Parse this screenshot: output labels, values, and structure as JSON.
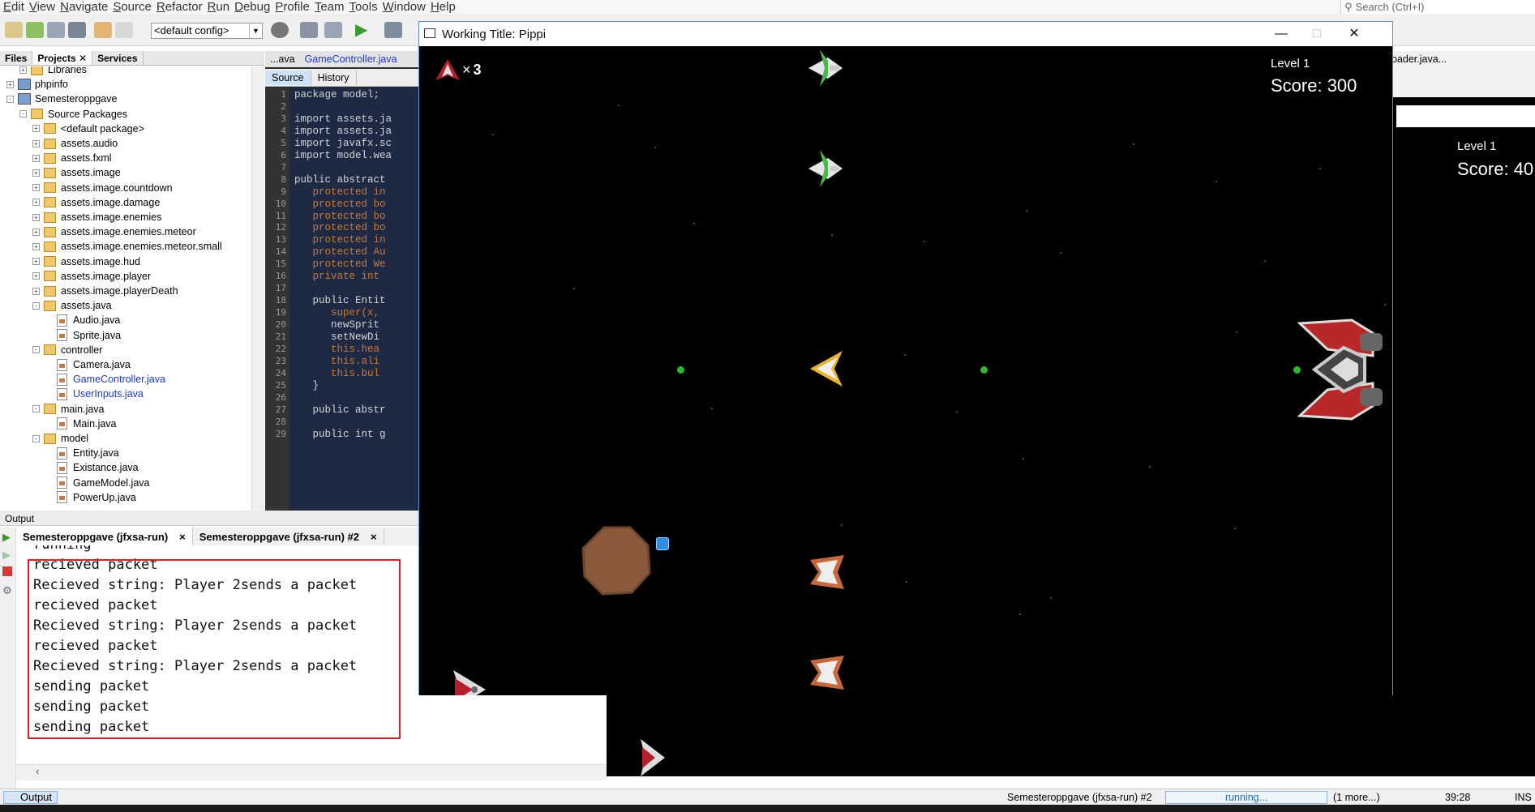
{
  "menu": [
    "Edit",
    "View",
    "Navigate",
    "Source",
    "Refactor",
    "Run",
    "Debug",
    "Profile",
    "Team",
    "Tools",
    "Window",
    "Help"
  ],
  "search": {
    "placeholder": "Search (Ctrl+I)"
  },
  "toolbar": {
    "config": "<default config>"
  },
  "project_tabs": [
    "Files",
    "Projects",
    "Services"
  ],
  "tree": [
    {
      "label": "Libraries",
      "indent": 1,
      "kind": "folder",
      "exp": "+"
    },
    {
      "label": "phpinfo",
      "indent": 0,
      "kind": "project",
      "exp": "+"
    },
    {
      "label": "Semesteroppgave",
      "indent": 0,
      "kind": "project",
      "exp": "-"
    },
    {
      "label": "Source Packages",
      "indent": 1,
      "kind": "pkg",
      "exp": "-"
    },
    {
      "label": "<default package>",
      "indent": 2,
      "kind": "pkg",
      "exp": "+"
    },
    {
      "label": "assets.audio",
      "indent": 2,
      "kind": "pkg",
      "exp": "+"
    },
    {
      "label": "assets.fxml",
      "indent": 2,
      "kind": "pkg",
      "exp": "+"
    },
    {
      "label": "assets.image",
      "indent": 2,
      "kind": "pkg",
      "exp": "+"
    },
    {
      "label": "assets.image.countdown",
      "indent": 2,
      "kind": "pkg",
      "exp": "+"
    },
    {
      "label": "assets.image.damage",
      "indent": 2,
      "kind": "pkg",
      "exp": "+"
    },
    {
      "label": "assets.image.enemies",
      "indent": 2,
      "kind": "pkg",
      "exp": "+"
    },
    {
      "label": "assets.image.enemies.meteor",
      "indent": 2,
      "kind": "pkg",
      "exp": "+"
    },
    {
      "label": "assets.image.enemies.meteor.small",
      "indent": 2,
      "kind": "pkg",
      "exp": "+"
    },
    {
      "label": "assets.image.hud",
      "indent": 2,
      "kind": "pkg",
      "exp": "+"
    },
    {
      "label": "assets.image.player",
      "indent": 2,
      "kind": "pkg",
      "exp": "+"
    },
    {
      "label": "assets.image.playerDeath",
      "indent": 2,
      "kind": "pkg",
      "exp": "+"
    },
    {
      "label": "assets.java",
      "indent": 2,
      "kind": "pkg",
      "exp": "-"
    },
    {
      "label": "Audio.java",
      "indent": 3,
      "kind": "file"
    },
    {
      "label": "Sprite.java",
      "indent": 3,
      "kind": "file"
    },
    {
      "label": "controller",
      "indent": 2,
      "kind": "pkg",
      "exp": "-"
    },
    {
      "label": "Camera.java",
      "indent": 3,
      "kind": "file"
    },
    {
      "label": "GameController.java",
      "indent": 3,
      "kind": "file",
      "blue": true
    },
    {
      "label": "UserInputs.java",
      "indent": 3,
      "kind": "file",
      "blue": true
    },
    {
      "label": "main.java",
      "indent": 2,
      "kind": "pkg",
      "exp": "-"
    },
    {
      "label": "Main.java",
      "indent": 3,
      "kind": "file"
    },
    {
      "label": "model",
      "indent": 2,
      "kind": "pkg",
      "exp": "-"
    },
    {
      "label": "Entity.java",
      "indent": 3,
      "kind": "file"
    },
    {
      "label": "Existance.java",
      "indent": 3,
      "kind": "file"
    },
    {
      "label": "GameModel.java",
      "indent": 3,
      "kind": "file"
    },
    {
      "label": "PowerUp.java",
      "indent": 3,
      "kind": "file"
    }
  ],
  "editor": {
    "tabs": [
      "...ava",
      "GameController.java"
    ],
    "source_tab": "Source",
    "history_tab": "History",
    "lines": [
      {
        "n": "1",
        "code": "package model;",
        "cls": "pl"
      },
      {
        "n": "2",
        "code": "",
        "cls": "pl"
      },
      {
        "n": "3",
        "code": "import assets.ja",
        "cls": "pl"
      },
      {
        "n": "4",
        "code": "import assets.ja",
        "cls": "pl"
      },
      {
        "n": "5",
        "code": "import javafx.sc",
        "cls": "pl"
      },
      {
        "n": "6",
        "code": "import model.wea",
        "cls": "pl"
      },
      {
        "n": "7",
        "code": "",
        "cls": "pl"
      },
      {
        "n": "8",
        "code": "public abstract",
        "cls": "pl"
      },
      {
        "n": "9",
        "code": "   protected in",
        "cls": "kw"
      },
      {
        "n": "10",
        "code": "   protected bo",
        "cls": "kw"
      },
      {
        "n": "11",
        "code": "   protected bo",
        "cls": "kw"
      },
      {
        "n": "12",
        "code": "   protected bo",
        "cls": "kw"
      },
      {
        "n": "13",
        "code": "   protected in",
        "cls": "kw"
      },
      {
        "n": "14",
        "code": "   protected Au",
        "cls": "kw"
      },
      {
        "n": "15",
        "code": "   protected We",
        "cls": "kw"
      },
      {
        "n": "16",
        "code": "   private int",
        "cls": "kw"
      },
      {
        "n": "17",
        "code": "",
        "cls": "pl"
      },
      {
        "n": "18",
        "code": "   public Entit",
        "cls": "pl"
      },
      {
        "n": "19",
        "code": "      super(x,",
        "cls": "kw"
      },
      {
        "n": "20",
        "code": "      newSprit",
        "cls": "pl"
      },
      {
        "n": "21",
        "code": "      setNewDi",
        "cls": "pl"
      },
      {
        "n": "22",
        "code": "      this.hea",
        "cls": "kw"
      },
      {
        "n": "23",
        "code": "      this.ali",
        "cls": "kw"
      },
      {
        "n": "24",
        "code": "      this.bul",
        "cls": "kw"
      },
      {
        "n": "25",
        "code": "   }",
        "cls": "pl"
      },
      {
        "n": "26",
        "code": "",
        "cls": "pl"
      },
      {
        "n": "27",
        "code": "   public abstr",
        "cls": "pl"
      },
      {
        "n": "28",
        "code": "",
        "cls": "pl"
      },
      {
        "n": "29",
        "code": "   public int g",
        "cls": "pl"
      }
    ]
  },
  "right_editor_tab": "oader.java...",
  "game": {
    "title": "Working Title: Pippi",
    "lives": "3",
    "level": "Level 1",
    "score": "Score: 300"
  },
  "game2": {
    "level": "Level 1",
    "score": "Score: 40"
  },
  "output": {
    "header": "Output",
    "tabs": [
      "Semesteroppgave (jfxsa-run)",
      "Semesteroppgave (jfxsa-run) #2"
    ],
    "lines": [
      "running",
      "recieved packet",
      "Recieved string: Player 2sends a packet",
      "recieved packet",
      "Recieved string: Player 2sends a packet",
      "recieved packet",
      "Recieved string: Player 2sends a packet",
      "sending packet",
      "sending packet",
      "sending packet"
    ]
  },
  "status": {
    "output_btn": "Output",
    "run_label": "Semesteroppgave (jfxsa-run) #2",
    "progress": "running...",
    "more": "(1 more...)",
    "clock": "39:28",
    "ins": "INS"
  },
  "colors": {
    "highlight_box": "#e0202a",
    "game_bg": "#000000",
    "code_bg": "#1e2a44"
  }
}
